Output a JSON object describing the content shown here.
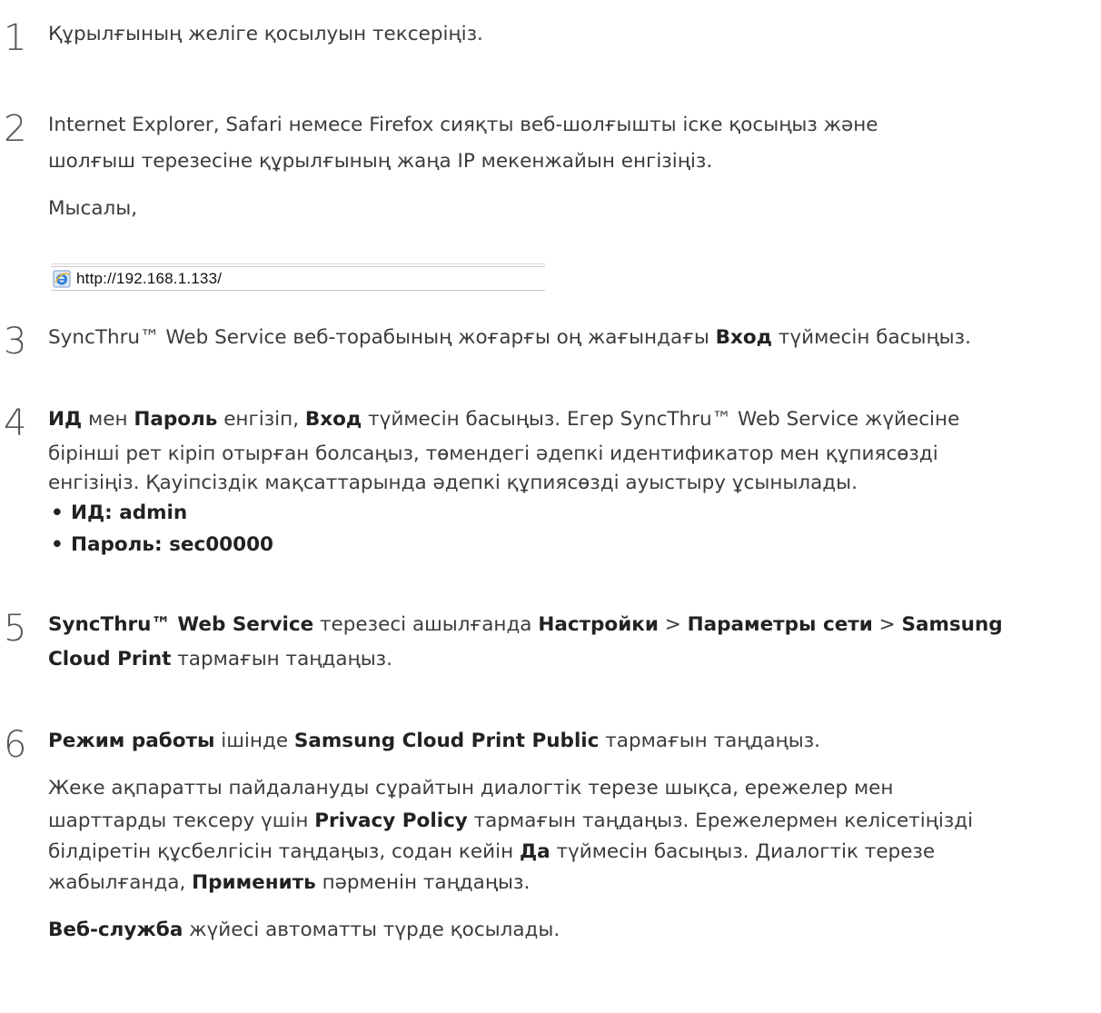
{
  "steps": {
    "s1": {
      "num": "1",
      "text": "Құрылғының желіге қосылуын тексеріңіз."
    },
    "s2": {
      "num": "2",
      "line1": "Internet Explorer, Safari немесе Firefox сияқты веб-шолғышты іске қосыңыз және",
      "line2": "шолғыш терезесіне құрылғының жаңа IP мекенжайын енгізіңіз.",
      "example": "Мысалы,",
      "url": "http://192.168.1.133/"
    },
    "s3": {
      "num": "3",
      "pre": "SyncThru™ Web Service веб-торабының жоғарғы оң жағындағы ",
      "b1": "Вход",
      "post": " түймесін басыңыз."
    },
    "s4": {
      "num": "4",
      "b1": "ИД",
      "t1": " мен ",
      "b2": "Пароль",
      "t2": " енгізіп, ",
      "b3": "Вход",
      "t3": " түймесін басыңыз. Егер SyncThru™ Web Service жүйесіне",
      "line2": "бірінші рет кіріп отырған болсаңыз, төмендегі әдепкі идентификатор мен құпиясөзді",
      "line3": "енгізіңіз. Қауіпсіздік мақсаттарында әдепкі құпиясөзді ауыстыру ұсынылады.",
      "bullet1": "ИД: admin",
      "bullet2": "Пароль: sec00000"
    },
    "s5": {
      "num": "5",
      "b1": "SyncThru™ Web Service",
      "t1": " терезесі ашылғанда ",
      "b2": "Настройки",
      "sep1": " > ",
      "b3": "Параметры сети",
      "sep2": " > ",
      "b4": "Samsung",
      "b5": "Cloud Print",
      "t2": " тармағын таңдаңыз."
    },
    "s6": {
      "num": "6",
      "b1": "Режим работы",
      "t1": " ішінде ",
      "b2": "Samsung Cloud Print Public",
      "t2": " тармағын таңдаңыз.",
      "p1": "Жеке ақпаратты пайдалануды сұрайтын диалогтік терезе шықса, ережелер мен",
      "p2a": "шарттарды тексеру үшін ",
      "p2b": "Privacy Policy",
      "p2c": " тармағын таңдаңыз. Ережелермен келісетіңізді",
      "p3a": "білдіретін құсбелгісін таңдаңыз, содан кейін ",
      "p3b": "Да",
      "p3c": " түймесін басыңыз. Диалогтік терезе",
      "p4a": "жабылғанда, ",
      "p4b": "Применить",
      "p4c": " пәрменін таңдаңыз.",
      "last_b": "Веб-служба",
      "last_t": " жүйесі автоматты түрде қосылады."
    }
  },
  "icons": {
    "browser": "internet-explorer-icon"
  },
  "colors": {
    "text": "#3c3c3c",
    "bold": "#222222",
    "step_number": "#555555"
  }
}
